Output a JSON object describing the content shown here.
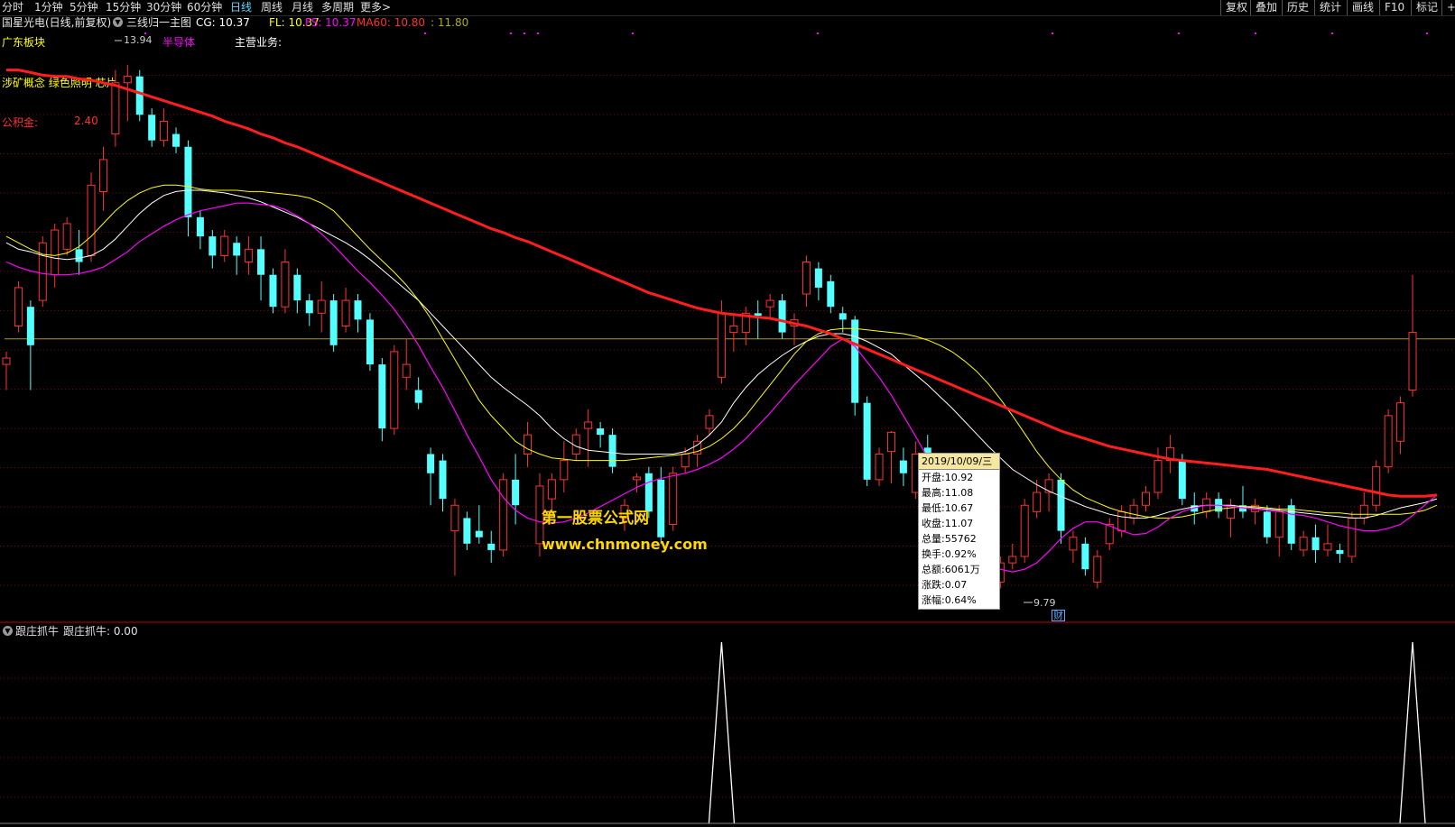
{
  "toolbar": {
    "timeframes": [
      "分时",
      "1分钟",
      "5分钟",
      "15分钟",
      "30分钟",
      "60分钟",
      "日线",
      "周线",
      "月线",
      "多周期",
      "更多>"
    ],
    "active_timeframe": "日线",
    "right_buttons": [
      "复权",
      "叠加",
      "历史",
      "统计",
      "画线",
      "F10",
      "标记",
      "+自"
    ]
  },
  "info": {
    "stock": "国星光电(日线,前复权)",
    "formula": "三线归一主图",
    "cg": "CG: 10.37",
    "fl": "FL: 10.37",
    "fs": "FS: 10.37",
    "ma60": "MA60: 10.80",
    "extra": ": 11.80"
  },
  "overlays": {
    "sector": "广东板块",
    "industry": "半导体",
    "main_business": "主营业务:",
    "concepts": "涉矿概念 绿色照明 芯片",
    "reserve_label": "公积金:",
    "reserve_value": "2.40",
    "high_price": "13.94",
    "low_price": "9.79",
    "finance_mark": "财"
  },
  "tooltip": {
    "date": "2019/10/09/三",
    "rows": [
      "开盘:10.92",
      "最高:11.08",
      "最低:10.67",
      "收盘:11.07",
      "总量:55762",
      "换手:0.92%",
      "总额:6061万",
      "涨跌:0.07",
      "涨幅:0.64%"
    ]
  },
  "watermark": {
    "line1": "第一股票公式网",
    "line2": "www.chnmoney.com"
  },
  "indicator": {
    "name": "跟庄抓牛",
    "value_label": "跟庄抓牛: 0.00"
  },
  "colors": {
    "up": "#ff3232",
    "down": "#54ffff",
    "ma60": "#ff1e1e",
    "cg": "#ffffff",
    "fl": "#ffff00",
    "fs": "#ff00ff",
    "grid": "#7a0000",
    "baseline": "#b59a00"
  },
  "chart_data": {
    "type": "candlestick",
    "y_range": [
      9.6,
      14.2
    ],
    "reference_price": 11.8,
    "candles": [
      {
        "o": 11.6,
        "h": 11.7,
        "l": 11.4,
        "c": 11.65
      },
      {
        "o": 11.9,
        "h": 12.25,
        "l": 11.85,
        "c": 12.2
      },
      {
        "o": 12.05,
        "h": 12.1,
        "l": 11.4,
        "c": 11.75
      },
      {
        "o": 12.1,
        "h": 12.6,
        "l": 12.05,
        "c": 12.55
      },
      {
        "o": 12.3,
        "h": 12.7,
        "l": 12.2,
        "c": 12.65
      },
      {
        "o": 12.5,
        "h": 12.75,
        "l": 12.45,
        "c": 12.7
      },
      {
        "o": 12.5,
        "h": 12.65,
        "l": 12.3,
        "c": 12.4
      },
      {
        "o": 12.45,
        "h": 13.1,
        "l": 12.4,
        "c": 13.0
      },
      {
        "o": 12.95,
        "h": 13.3,
        "l": 12.8,
        "c": 13.2
      },
      {
        "o": 13.4,
        "h": 13.9,
        "l": 13.3,
        "c": 13.8
      },
      {
        "o": 13.8,
        "h": 13.94,
        "l": 13.5,
        "c": 13.85
      },
      {
        "o": 13.85,
        "h": 13.9,
        "l": 13.5,
        "c": 13.55
      },
      {
        "o": 13.55,
        "h": 13.6,
        "l": 13.3,
        "c": 13.35
      },
      {
        "o": 13.35,
        "h": 13.6,
        "l": 13.3,
        "c": 13.5
      },
      {
        "o": 13.4,
        "h": 13.45,
        "l": 13.25,
        "c": 13.3
      },
      {
        "o": 13.3,
        "h": 13.35,
        "l": 12.6,
        "c": 12.75
      },
      {
        "o": 12.75,
        "h": 12.8,
        "l": 12.5,
        "c": 12.6
      },
      {
        "o": 12.6,
        "h": 12.65,
        "l": 12.35,
        "c": 12.45
      },
      {
        "o": 12.45,
        "h": 12.65,
        "l": 12.4,
        "c": 12.6
      },
      {
        "o": 12.55,
        "h": 12.6,
        "l": 12.3,
        "c": 12.45
      },
      {
        "o": 12.4,
        "h": 12.6,
        "l": 12.3,
        "c": 12.5
      },
      {
        "o": 12.5,
        "h": 12.6,
        "l": 12.1,
        "c": 12.3
      },
      {
        "o": 12.3,
        "h": 12.35,
        "l": 12.0,
        "c": 12.05
      },
      {
        "o": 12.05,
        "h": 12.5,
        "l": 12.0,
        "c": 12.4
      },
      {
        "o": 12.3,
        "h": 12.35,
        "l": 12.0,
        "c": 12.1
      },
      {
        "o": 12.1,
        "h": 12.15,
        "l": 11.9,
        "c": 12.0
      },
      {
        "o": 12.0,
        "h": 12.25,
        "l": 11.85,
        "c": 12.1
      },
      {
        "o": 12.1,
        "h": 12.15,
        "l": 11.7,
        "c": 11.75
      },
      {
        "o": 11.9,
        "h": 12.2,
        "l": 11.85,
        "c": 12.1
      },
      {
        "o": 12.1,
        "h": 12.15,
        "l": 11.85,
        "c": 11.95
      },
      {
        "o": 11.95,
        "h": 12.0,
        "l": 11.55,
        "c": 11.6
      },
      {
        "o": 11.6,
        "h": 11.65,
        "l": 11.0,
        "c": 11.1
      },
      {
        "o": 11.1,
        "h": 11.75,
        "l": 11.05,
        "c": 11.7
      },
      {
        "o": 11.5,
        "h": 11.8,
        "l": 11.4,
        "c": 11.6
      },
      {
        "o": 11.4,
        "h": 11.5,
        "l": 11.25,
        "c": 11.3
      },
      {
        "o": 10.9,
        "h": 10.95,
        "l": 10.5,
        "c": 10.75
      },
      {
        "o": 10.85,
        "h": 10.9,
        "l": 10.45,
        "c": 10.55
      },
      {
        "o": 10.3,
        "h": 10.55,
        "l": 9.95,
        "c": 10.5
      },
      {
        "o": 10.4,
        "h": 10.45,
        "l": 10.15,
        "c": 10.2
      },
      {
        "o": 10.3,
        "h": 10.5,
        "l": 10.2,
        "c": 10.25
      },
      {
        "o": 10.2,
        "h": 10.3,
        "l": 10.05,
        "c": 10.15
      },
      {
        "o": 10.15,
        "h": 10.75,
        "l": 10.1,
        "c": 10.7
      },
      {
        "o": 10.7,
        "h": 10.9,
        "l": 10.35,
        "c": 10.5
      },
      {
        "o": 10.9,
        "h": 11.15,
        "l": 10.8,
        "c": 11.05
      },
      {
        "o": 10.2,
        "h": 10.75,
        "l": 10.1,
        "c": 10.65
      },
      {
        "o": 10.55,
        "h": 10.75,
        "l": 10.4,
        "c": 10.7
      },
      {
        "o": 10.7,
        "h": 11.0,
        "l": 10.6,
        "c": 10.85
      },
      {
        "o": 10.9,
        "h": 11.1,
        "l": 10.85,
        "c": 11.05
      },
      {
        "o": 11.1,
        "h": 11.25,
        "l": 10.8,
        "c": 11.15
      },
      {
        "o": 11.1,
        "h": 11.15,
        "l": 10.95,
        "c": 11.05
      },
      {
        "o": 11.05,
        "h": 11.1,
        "l": 10.75,
        "c": 10.8
      },
      {
        "o": 10.4,
        "h": 10.55,
        "l": 10.3,
        "c": 10.5
      },
      {
        "o": 10.7,
        "h": 10.75,
        "l": 10.6,
        "c": 10.72
      },
      {
        "o": 10.75,
        "h": 10.8,
        "l": 10.4,
        "c": 10.45
      },
      {
        "o": 10.7,
        "h": 10.8,
        "l": 10.2,
        "c": 10.25
      },
      {
        "o": 10.35,
        "h": 10.8,
        "l": 10.3,
        "c": 10.75
      },
      {
        "o": 10.8,
        "h": 10.95,
        "l": 10.75,
        "c": 10.9
      },
      {
        "o": 10.9,
        "h": 11.05,
        "l": 10.8,
        "c": 11.0
      },
      {
        "o": 11.1,
        "h": 11.25,
        "l": 11.05,
        "c": 11.2
      },
      {
        "o": 11.5,
        "h": 12.1,
        "l": 11.45,
        "c": 12.0
      },
      {
        "o": 11.85,
        "h": 12.0,
        "l": 11.7,
        "c": 11.9
      },
      {
        "o": 11.85,
        "h": 12.05,
        "l": 11.75,
        "c": 12.0
      },
      {
        "o": 12.0,
        "h": 12.1,
        "l": 11.8,
        "c": 11.98
      },
      {
        "o": 12.05,
        "h": 12.15,
        "l": 11.95,
        "c": 12.1
      },
      {
        "o": 12.1,
        "h": 12.15,
        "l": 11.8,
        "c": 11.85
      },
      {
        "o": 11.9,
        "h": 12.0,
        "l": 11.75,
        "c": 11.95
      },
      {
        "o": 12.15,
        "h": 12.45,
        "l": 12.05,
        "c": 12.4
      },
      {
        "o": 12.35,
        "h": 12.4,
        "l": 12.1,
        "c": 12.2
      },
      {
        "o": 12.25,
        "h": 12.3,
        "l": 12.0,
        "c": 12.05
      },
      {
        "o": 12.0,
        "h": 12.05,
        "l": 11.85,
        "c": 11.95
      },
      {
        "o": 11.95,
        "h": 11.98,
        "l": 11.2,
        "c": 11.3
      },
      {
        "o": 11.3,
        "h": 11.35,
        "l": 10.65,
        "c": 10.7
      },
      {
        "o": 10.7,
        "h": 10.95,
        "l": 10.65,
        "c": 10.9
      },
      {
        "o": 10.92,
        "h": 11.08,
        "l": 10.67,
        "c": 11.07
      },
      {
        "o": 10.85,
        "h": 10.95,
        "l": 10.65,
        "c": 10.75
      },
      {
        "o": 10.6,
        "h": 11.0,
        "l": 10.55,
        "c": 10.9
      },
      {
        "o": 10.95,
        "h": 11.05,
        "l": 10.7,
        "c": 10.75
      },
      {
        "o": 10.8,
        "h": 10.9,
        "l": 10.3,
        "c": 10.35
      },
      {
        "o": 10.35,
        "h": 10.65,
        "l": 10.25,
        "c": 10.6
      },
      {
        "o": 10.5,
        "h": 10.6,
        "l": 10.4,
        "c": 10.45
      },
      {
        "o": 10.5,
        "h": 10.55,
        "l": 10.1,
        "c": 10.2
      },
      {
        "o": 10.05,
        "h": 10.1,
        "l": 9.79,
        "c": 9.95
      },
      {
        "o": 9.9,
        "h": 10.1,
        "l": 9.85,
        "c": 10.05
      },
      {
        "o": 10.05,
        "h": 10.2,
        "l": 10.0,
        "c": 10.1
      },
      {
        "o": 10.1,
        "h": 10.55,
        "l": 10.05,
        "c": 10.5
      },
      {
        "o": 10.45,
        "h": 10.7,
        "l": 10.4,
        "c": 10.6
      },
      {
        "o": 10.6,
        "h": 10.75,
        "l": 10.45,
        "c": 10.7
      },
      {
        "o": 10.7,
        "h": 10.75,
        "l": 10.2,
        "c": 10.3
      },
      {
        "o": 10.15,
        "h": 10.3,
        "l": 10.05,
        "c": 10.25
      },
      {
        "o": 10.2,
        "h": 10.25,
        "l": 9.95,
        "c": 10.0
      },
      {
        "o": 9.9,
        "h": 10.15,
        "l": 9.85,
        "c": 10.1
      },
      {
        "o": 10.2,
        "h": 10.4,
        "l": 10.15,
        "c": 10.35
      },
      {
        "o": 10.3,
        "h": 10.5,
        "l": 10.25,
        "c": 10.45
      },
      {
        "o": 10.4,
        "h": 10.55,
        "l": 10.35,
        "c": 10.5
      },
      {
        "o": 10.5,
        "h": 10.65,
        "l": 10.45,
        "c": 10.6
      },
      {
        "o": 10.6,
        "h": 10.95,
        "l": 10.55,
        "c": 10.85
      },
      {
        "o": 10.85,
        "h": 11.05,
        "l": 10.75,
        "c": 10.95
      },
      {
        "o": 10.85,
        "h": 10.9,
        "l": 10.5,
        "c": 10.55
      },
      {
        "o": 10.5,
        "h": 10.6,
        "l": 10.35,
        "c": 10.45
      },
      {
        "o": 10.45,
        "h": 10.6,
        "l": 10.4,
        "c": 10.55
      },
      {
        "o": 10.55,
        "h": 10.6,
        "l": 10.4,
        "c": 10.45
      },
      {
        "o": 10.4,
        "h": 10.55,
        "l": 10.25,
        "c": 10.5
      },
      {
        "o": 10.5,
        "h": 10.65,
        "l": 10.4,
        "c": 10.45
      },
      {
        "o": 10.45,
        "h": 10.55,
        "l": 10.35,
        "c": 10.5
      },
      {
        "o": 10.45,
        "h": 10.5,
        "l": 10.2,
        "c": 10.25
      },
      {
        "o": 10.25,
        "h": 10.5,
        "l": 10.1,
        "c": 10.45
      },
      {
        "o": 10.5,
        "h": 10.55,
        "l": 10.15,
        "c": 10.2
      },
      {
        "o": 10.15,
        "h": 10.3,
        "l": 10.1,
        "c": 10.25
      },
      {
        "o": 10.25,
        "h": 10.35,
        "l": 10.05,
        "c": 10.15
      },
      {
        "o": 10.15,
        "h": 10.35,
        "l": 10.1,
        "c": 10.2
      },
      {
        "o": 10.15,
        "h": 10.2,
        "l": 10.05,
        "c": 10.12
      },
      {
        "o": 10.1,
        "h": 10.45,
        "l": 10.05,
        "c": 10.4
      },
      {
        "o": 10.4,
        "h": 10.6,
        "l": 10.35,
        "c": 10.5
      },
      {
        "o": 10.5,
        "h": 10.85,
        "l": 10.45,
        "c": 10.8
      },
      {
        "o": 10.8,
        "h": 11.25,
        "l": 10.75,
        "c": 11.2
      },
      {
        "o": 11.0,
        "h": 11.35,
        "l": 10.9,
        "c": 11.3
      },
      {
        "o": 11.4,
        "h": 12.3,
        "l": 11.35,
        "c": 11.85
      }
    ],
    "ma60": [
      13.9,
      13.9,
      13.88,
      13.86,
      13.85,
      13.85,
      13.83,
      13.82,
      13.8,
      13.78,
      13.75,
      13.72,
      13.69,
      13.66,
      13.63,
      13.6,
      13.57,
      13.54,
      13.5,
      13.47,
      13.44,
      13.4,
      13.37,
      13.33,
      13.3,
      13.26,
      13.22,
      13.18,
      13.14,
      13.1,
      13.06,
      13.02,
      12.98,
      12.94,
      12.9,
      12.86,
      12.82,
      12.78,
      12.74,
      12.7,
      12.66,
      12.63,
      12.59,
      12.56,
      12.52,
      12.48,
      12.44,
      12.4,
      12.36,
      12.32,
      12.28,
      12.24,
      12.2,
      12.16,
      12.13,
      12.1,
      12.07,
      12.04,
      12.02,
      12.0,
      11.99,
      11.98,
      11.97,
      11.96,
      11.94,
      11.92,
      11.9,
      11.87,
      11.84,
      11.8,
      11.76,
      11.72,
      11.68,
      11.64,
      11.6,
      11.56,
      11.52,
      11.48,
      11.44,
      11.4,
      11.36,
      11.32,
      11.28,
      11.24,
      11.2,
      11.16,
      11.12,
      11.08,
      11.05,
      11.02,
      10.99,
      10.96,
      10.94,
      10.92,
      10.9,
      10.88,
      10.86,
      10.85,
      10.84,
      10.83,
      10.82,
      10.81,
      10.8,
      10.79,
      10.78,
      10.76,
      10.74,
      10.72,
      10.7,
      10.68,
      10.66,
      10.64,
      10.62,
      10.6,
      10.58,
      10.57,
      10.57,
      10.57,
      10.58
    ],
    "cg": [
      12.55,
      12.5,
      12.48,
      12.45,
      12.43,
      12.42,
      12.43,
      12.45,
      12.5,
      12.58,
      12.68,
      12.78,
      12.86,
      12.92,
      12.95,
      12.96,
      12.96,
      12.95,
      12.94,
      12.92,
      12.9,
      12.87,
      12.83,
      12.79,
      12.75,
      12.7,
      12.65,
      12.6,
      12.55,
      12.49,
      12.42,
      12.34,
      12.26,
      12.18,
      12.1,
      12.0,
      11.9,
      11.8,
      11.7,
      11.6,
      11.5,
      11.42,
      11.35,
      11.28,
      11.2,
      11.1,
      11.02,
      10.96,
      10.93,
      10.92,
      10.91,
      10.9,
      10.9,
      10.9,
      10.9,
      10.9,
      10.92,
      10.97,
      11.05,
      11.15,
      11.3,
      11.42,
      11.52,
      11.6,
      11.67,
      11.73,
      11.78,
      11.82,
      11.84,
      11.84,
      11.82,
      11.78,
      11.73,
      11.68,
      11.6,
      11.52,
      11.44,
      11.35,
      11.26,
      11.16,
      11.06,
      10.96,
      10.87,
      10.78,
      10.72,
      10.66,
      10.61,
      10.57,
      10.53,
      10.49,
      10.46,
      10.43,
      10.41,
      10.4,
      10.4,
      10.42,
      10.45,
      10.47,
      10.49,
      10.5,
      10.5,
      10.5,
      10.49,
      10.48,
      10.47,
      10.46,
      10.45,
      10.44,
      10.43,
      10.42,
      10.41,
      10.4,
      10.4,
      10.42,
      10.45,
      10.48,
      10.5,
      10.52,
      10.55
    ],
    "fl": [
      12.6,
      12.55,
      12.5,
      12.46,
      12.45,
      12.47,
      12.52,
      12.6,
      12.7,
      12.8,
      12.88,
      12.94,
      12.98,
      13.0,
      13.0,
      12.99,
      12.97,
      12.96,
      12.96,
      12.96,
      12.95,
      12.95,
      12.94,
      12.93,
      12.92,
      12.9,
      12.86,
      12.8,
      12.7,
      12.6,
      12.5,
      12.41,
      12.32,
      12.22,
      12.1,
      11.96,
      11.8,
      11.64,
      11.48,
      11.32,
      11.2,
      11.1,
      11.0,
      10.94,
      10.9,
      10.87,
      10.86,
      10.85,
      10.85,
      10.85,
      10.85,
      10.85,
      10.86,
      10.87,
      10.88,
      10.89,
      10.9,
      10.92,
      10.96,
      11.02,
      11.1,
      11.2,
      11.32,
      11.44,
      11.56,
      11.68,
      11.78,
      11.84,
      11.87,
      11.88,
      11.88,
      11.87,
      11.86,
      11.85,
      11.84,
      11.82,
      11.79,
      11.75,
      11.7,
      11.63,
      11.55,
      11.45,
      11.33,
      11.2,
      11.06,
      10.92,
      10.8,
      10.7,
      10.62,
      10.56,
      10.52,
      10.48,
      10.45,
      10.43,
      10.41,
      10.4,
      10.4,
      10.41,
      10.43,
      10.45,
      10.47,
      10.48,
      10.49,
      10.49,
      10.48,
      10.47,
      10.47,
      10.46,
      10.45,
      10.44,
      10.44,
      10.43,
      10.43,
      10.43,
      10.43,
      10.43,
      10.44,
      10.46,
      10.5
    ],
    "fs": [
      12.4,
      12.36,
      12.33,
      12.31,
      12.3,
      12.3,
      12.31,
      12.33,
      12.36,
      12.42,
      12.48,
      12.56,
      12.62,
      12.68,
      12.73,
      12.77,
      12.8,
      12.82,
      12.84,
      12.86,
      12.86,
      12.85,
      12.84,
      12.81,
      12.76,
      12.7,
      12.62,
      12.53,
      12.43,
      12.33,
      12.24,
      12.14,
      12.03,
      11.9,
      11.75,
      11.58,
      11.42,
      11.24,
      11.05,
      10.88,
      10.7,
      10.56,
      10.46,
      10.4,
      10.37,
      10.36,
      10.37,
      10.4,
      10.44,
      10.49,
      10.54,
      10.59,
      10.64,
      10.68,
      10.71,
      10.73,
      10.75,
      10.78,
      10.82,
      10.87,
      10.94,
      11.02,
      11.12,
      11.22,
      11.33,
      11.44,
      11.54,
      11.64,
      11.74,
      11.8,
      11.74,
      11.62,
      11.5,
      11.36,
      11.2,
      11.04,
      10.87,
      10.7,
      10.52,
      10.35,
      10.2,
      10.08,
      10.0,
      9.98,
      10.0,
      10.05,
      10.14,
      10.24,
      10.32,
      10.37,
      10.37,
      10.34,
      10.3,
      10.27,
      10.28,
      10.33,
      10.4,
      10.45,
      10.48,
      10.5,
      10.5,
      10.49,
      10.48,
      10.47,
      10.46,
      10.45,
      10.43,
      10.42,
      10.4,
      10.37,
      10.34,
      10.32,
      10.3,
      10.3,
      10.32,
      10.35,
      10.42,
      10.5,
      10.58
    ],
    "indicator_values_nonzero": [
      {
        "index": 59,
        "value": 1
      },
      {
        "index": 116,
        "value": 1
      }
    ],
    "indicator_range": [
      0,
      1
    ]
  }
}
